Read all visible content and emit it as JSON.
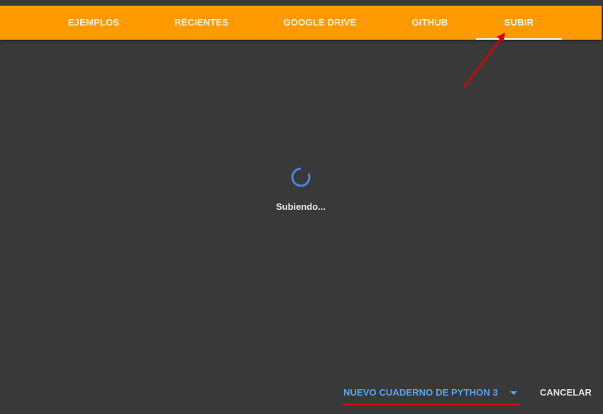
{
  "tabs": [
    {
      "label": "EJEMPLOS"
    },
    {
      "label": "RECIENTES"
    },
    {
      "label": "GOOGLE DRIVE"
    },
    {
      "label": "GITHUB"
    },
    {
      "label": "SUBIR",
      "active": true
    }
  ],
  "main": {
    "status_text": "Subiendo..."
  },
  "footer": {
    "new_notebook_label": "NUEVO CUADERNO DE PYTHON 3",
    "cancel_label": "CANCELAR"
  },
  "colors": {
    "tabbar": "#ff9a00",
    "background": "#393939",
    "accent_blue": "#5aa4ee",
    "spinner": "#4a86e8",
    "annotation_red": "#e00000"
  },
  "icons": {
    "spinner": "loading-spinner-icon",
    "dropdown": "chevron-down-icon"
  }
}
